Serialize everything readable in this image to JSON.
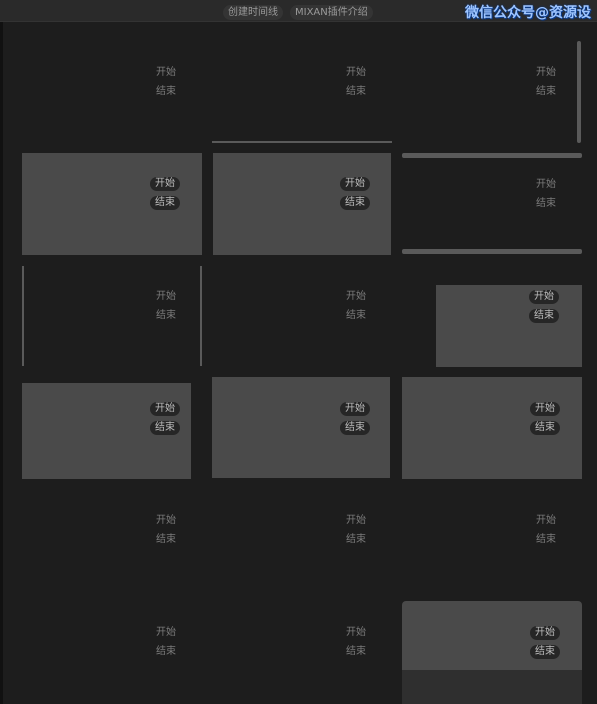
{
  "toolbar": {
    "create_timeline": "创建时间线",
    "plugin_intro": "MIXAN插件介绍"
  },
  "watermark": "微信公众号@资源设",
  "cards": [
    {
      "start": "开始",
      "end": "结束"
    },
    {
      "start": "开始",
      "end": "结束"
    },
    {
      "start": "开始",
      "end": "结束"
    },
    {
      "start": "开始",
      "end": "结束"
    },
    {
      "start": "开始",
      "end": "结束"
    },
    {
      "start": "开始",
      "end": "结束"
    },
    {
      "start": "开始",
      "end": "结束"
    },
    {
      "start": "开始",
      "end": "结束"
    },
    {
      "start": "开始",
      "end": "结束"
    },
    {
      "start": "开始",
      "end": "结束"
    },
    {
      "start": "开始",
      "end": "结束"
    },
    {
      "start": "开始",
      "end": "结束"
    },
    {
      "start": "开始",
      "end": "结束"
    },
    {
      "start": "开始",
      "end": "结束"
    },
    {
      "start": "开始",
      "end": "结束"
    },
    {
      "start": "开始",
      "end": "结束"
    },
    {
      "start": "开始",
      "end": "结束"
    },
    {
      "start": "开始",
      "end": "结束"
    }
  ]
}
